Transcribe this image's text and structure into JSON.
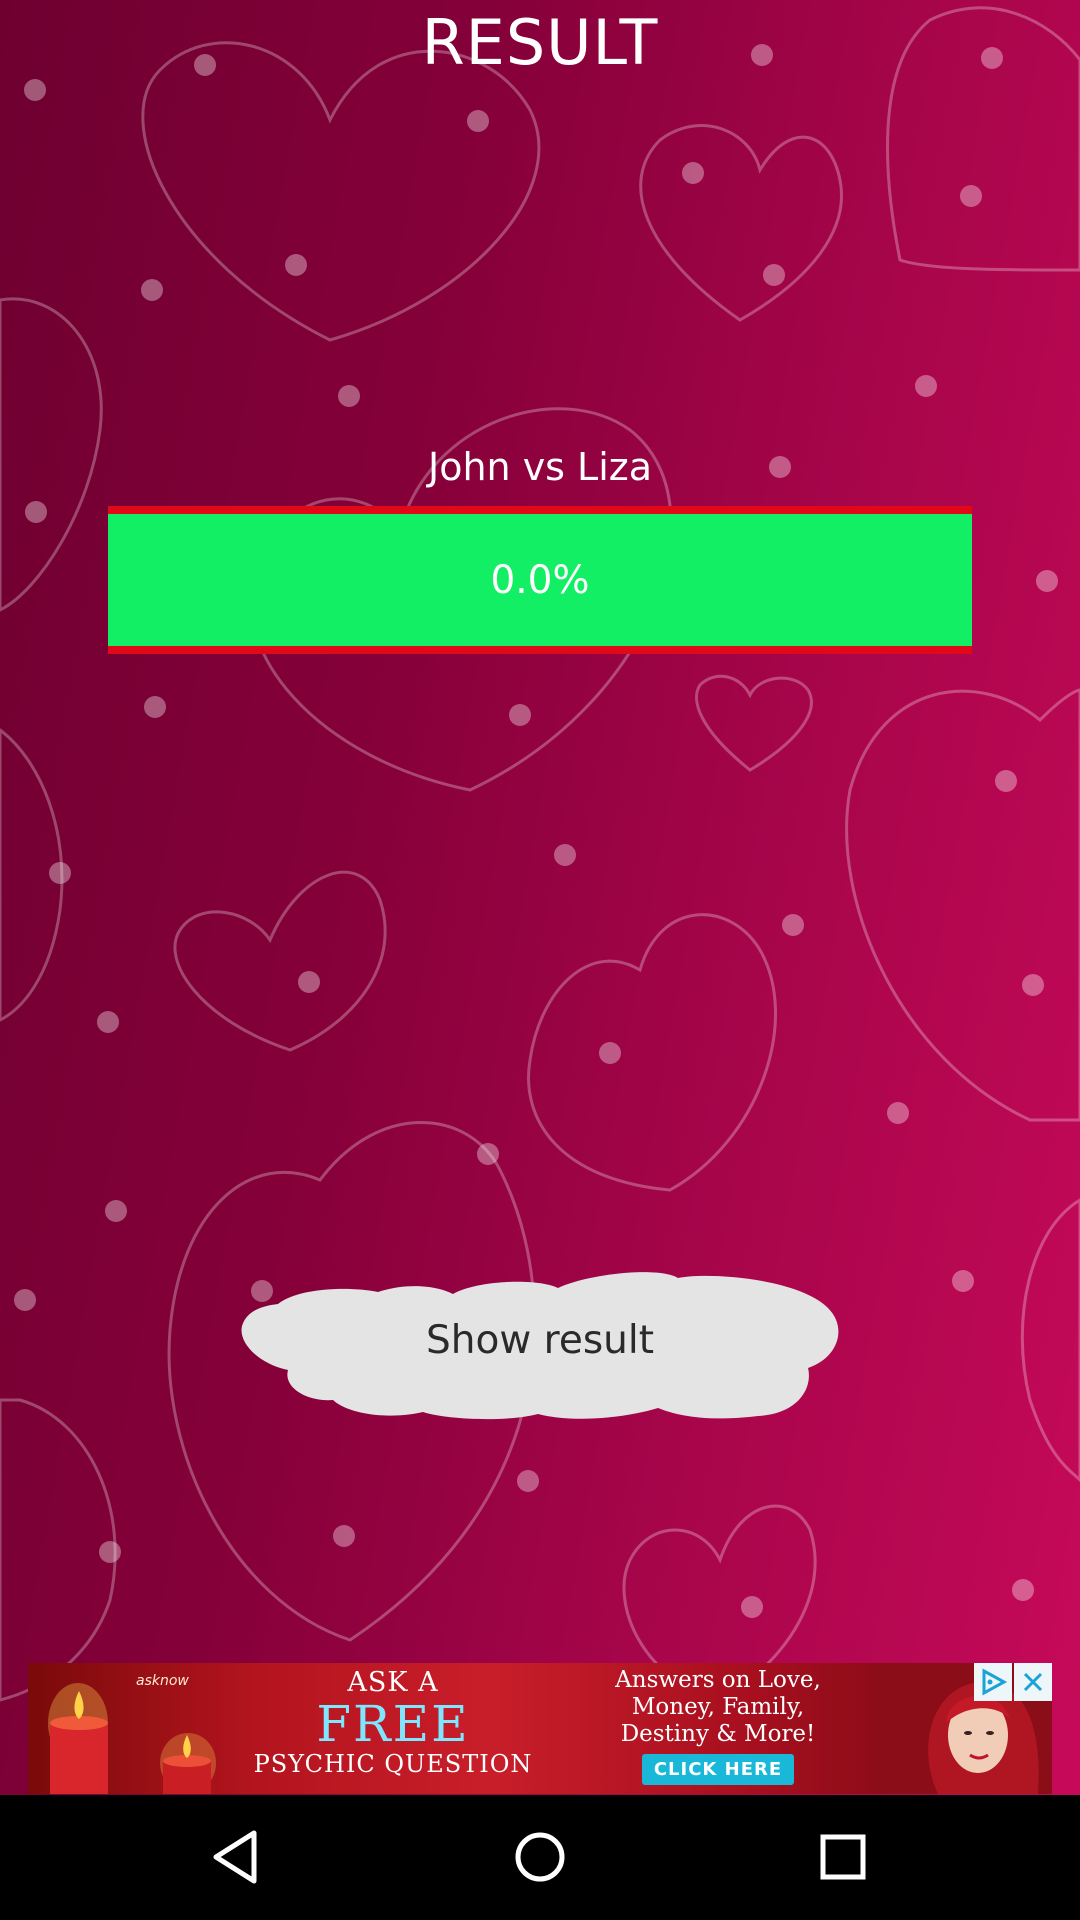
{
  "header": {
    "title": "RESULT"
  },
  "match": {
    "names_label": "John vs Liza",
    "percentage_text": "0.0%"
  },
  "actions": {
    "show_result_label": "Show result"
  },
  "ad": {
    "brand": "asknow",
    "line1": "ASK A",
    "line2": "FREE",
    "line3": "PSYCHIC QUESTION",
    "right_text_1": "Answers on Love,",
    "right_text_2": "Money, Family,",
    "right_text_3": "Destiny & More!",
    "cta": "CLICK HERE",
    "choices_icon": "ad-choices-icon",
    "close_icon": "close-icon"
  },
  "nav": {
    "back_icon": "back-triangle-icon",
    "home_icon": "home-circle-icon",
    "recents_icon": "recents-square-icon"
  },
  "colors": {
    "background_dark": "#6e0030",
    "background_light": "#c80a5a",
    "bar_border": "#e10818",
    "bar_fill": "#13ef64",
    "button_cloud": "#e4e4e4"
  }
}
